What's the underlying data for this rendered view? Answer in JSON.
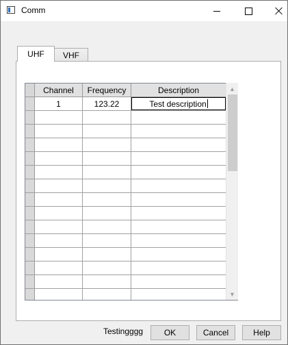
{
  "window": {
    "title": "Comm"
  },
  "tabs": [
    {
      "label": "UHF",
      "selected": true
    },
    {
      "label": "VHF",
      "selected": false
    }
  ],
  "grid": {
    "columns": [
      "Channel",
      "Frequency",
      "Description"
    ],
    "rows": [
      {
        "channel": "1",
        "frequency": "123.22",
        "description": "Test description"
      }
    ]
  },
  "footer": {
    "status_text": "Testingggg",
    "ok_label": "OK",
    "cancel_label": "Cancel",
    "help_label": "Help"
  },
  "colors": {
    "window_bg": "#f0f0f0",
    "grid_bg": "#ababab",
    "header_bg": "#e1e1e1",
    "button_bg": "#e1e1e1"
  }
}
